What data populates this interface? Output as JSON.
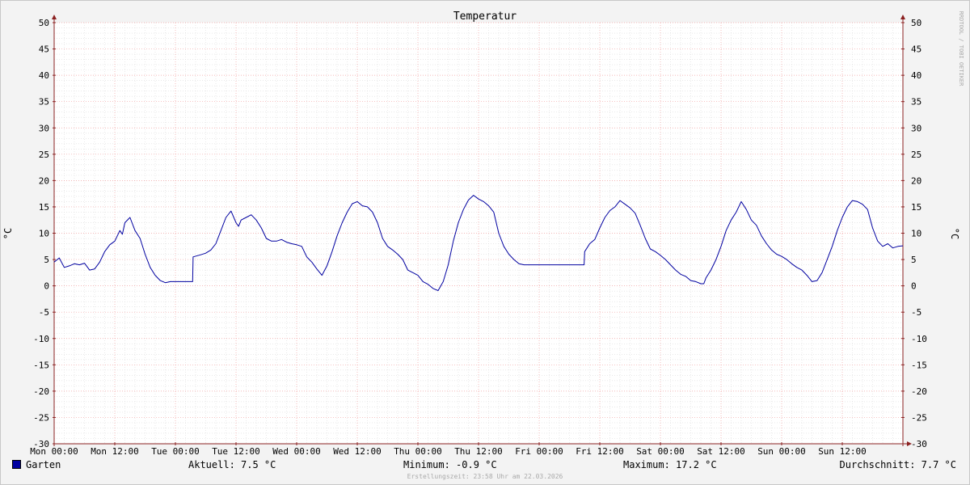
{
  "chart_data": {
    "type": "line",
    "title": "Temperatur",
    "ylabel": "°C",
    "ylabel_right": "°C",
    "watermark": "RRDTOOL / TOBI OETIKER",
    "ylim": [
      -30,
      50
    ],
    "y_ticks": [
      50,
      45,
      40,
      35,
      30,
      25,
      20,
      15,
      10,
      5,
      0,
      -5,
      -10,
      -15,
      -20,
      -25,
      -30
    ],
    "xlim": [
      0,
      168
    ],
    "x_ticks": [
      {
        "x": 0,
        "label": "Mon 00:00"
      },
      {
        "x": 12,
        "label": "Mon 12:00"
      },
      {
        "x": 24,
        "label": "Tue 00:00"
      },
      {
        "x": 36,
        "label": "Tue 12:00"
      },
      {
        "x": 48,
        "label": "Wed 00:00"
      },
      {
        "x": 60,
        "label": "Wed 12:00"
      },
      {
        "x": 72,
        "label": "Thu 00:00"
      },
      {
        "x": 84,
        "label": "Thu 12:00"
      },
      {
        "x": 96,
        "label": "Fri 00:00"
      },
      {
        "x": 108,
        "label": "Fri 12:00"
      },
      {
        "x": 120,
        "label": "Sat 00:00"
      },
      {
        "x": 132,
        "label": "Sat 12:00"
      },
      {
        "x": 144,
        "label": "Sun 00:00"
      },
      {
        "x": 156,
        "label": "Sun 12:00"
      }
    ],
    "grid": true,
    "legend_position": "bottom-left",
    "series": [
      {
        "name": "Garten",
        "color": "#0000a0",
        "points": [
          [
            0,
            4.5
          ],
          [
            1,
            5.3
          ],
          [
            2,
            3.5
          ],
          [
            3,
            3.8
          ],
          [
            4,
            4.2
          ],
          [
            5,
            4.0
          ],
          [
            6,
            4.3
          ],
          [
            7,
            3.0
          ],
          [
            8,
            3.2
          ],
          [
            9,
            4.5
          ],
          [
            10,
            6.5
          ],
          [
            11,
            7.8
          ],
          [
            12,
            8.5
          ],
          [
            13,
            10.5
          ],
          [
            13.5,
            9.8
          ],
          [
            14,
            12.0
          ],
          [
            15,
            13.0
          ],
          [
            16,
            10.5
          ],
          [
            17,
            9.0
          ],
          [
            18,
            6.0
          ],
          [
            19,
            3.5
          ],
          [
            20,
            2.0
          ],
          [
            21,
            1.0
          ],
          [
            22,
            0.6
          ],
          [
            23,
            0.8
          ],
          [
            24,
            0.8
          ],
          [
            25,
            0.8
          ],
          [
            27.4,
            0.8
          ],
          [
            27.5,
            5.5
          ],
          [
            29,
            5.9
          ],
          [
            30,
            6.2
          ],
          [
            31,
            6.8
          ],
          [
            32,
            8.0
          ],
          [
            33,
            10.5
          ],
          [
            34,
            13.0
          ],
          [
            35,
            14.2
          ],
          [
            36,
            12.0
          ],
          [
            36.5,
            11.3
          ],
          [
            37,
            12.5
          ],
          [
            38,
            13.0
          ],
          [
            39,
            13.5
          ],
          [
            40,
            12.5
          ],
          [
            41,
            11.0
          ],
          [
            42,
            9.0
          ],
          [
            43,
            8.5
          ],
          [
            44,
            8.5
          ],
          [
            45,
            8.8
          ],
          [
            46,
            8.3
          ],
          [
            47,
            8.0
          ],
          [
            48,
            7.8
          ],
          [
            49,
            7.5
          ],
          [
            50,
            5.5
          ],
          [
            51,
            4.5
          ],
          [
            52,
            3.2
          ],
          [
            53,
            2.0
          ],
          [
            54,
            3.8
          ],
          [
            55,
            6.5
          ],
          [
            56,
            9.5
          ],
          [
            57,
            12.0
          ],
          [
            58,
            14.0
          ],
          [
            59,
            15.6
          ],
          [
            60,
            16.0
          ],
          [
            61,
            15.2
          ],
          [
            62,
            15.0
          ],
          [
            63,
            14.0
          ],
          [
            64,
            12.0
          ],
          [
            65,
            9.0
          ],
          [
            66,
            7.5
          ],
          [
            67,
            6.8
          ],
          [
            68,
            6.0
          ],
          [
            69,
            5.0
          ],
          [
            70,
            3.0
          ],
          [
            71,
            2.5
          ],
          [
            72,
            2.0
          ],
          [
            73,
            0.8
          ],
          [
            74,
            0.3
          ],
          [
            75,
            -0.5
          ],
          [
            76,
            -0.9
          ],
          [
            77,
            0.8
          ],
          [
            78,
            4.0
          ],
          [
            79,
            8.5
          ],
          [
            80,
            12.0
          ],
          [
            81,
            14.5
          ],
          [
            82,
            16.3
          ],
          [
            83,
            17.2
          ],
          [
            84,
            16.5
          ],
          [
            85,
            16.0
          ],
          [
            86,
            15.2
          ],
          [
            87,
            14.0
          ],
          [
            88,
            10.0
          ],
          [
            89,
            7.5
          ],
          [
            90,
            6.0
          ],
          [
            91,
            5.0
          ],
          [
            92,
            4.2
          ],
          [
            93,
            4.0
          ],
          [
            97,
            4.0
          ],
          [
            101,
            4.0
          ],
          [
            104.9,
            4.0
          ],
          [
            105,
            6.5
          ],
          [
            106,
            8.0
          ],
          [
            107,
            8.8
          ],
          [
            108,
            11.0
          ],
          [
            109,
            13.0
          ],
          [
            110,
            14.3
          ],
          [
            111,
            15.0
          ],
          [
            112,
            16.2
          ],
          [
            113,
            15.5
          ],
          [
            114,
            14.8
          ],
          [
            115,
            13.8
          ],
          [
            116,
            11.5
          ],
          [
            117,
            9.0
          ],
          [
            118,
            7.0
          ],
          [
            119,
            6.5
          ],
          [
            120,
            5.8
          ],
          [
            121,
            5.0
          ],
          [
            122,
            4.0
          ],
          [
            123,
            3.0
          ],
          [
            124,
            2.2
          ],
          [
            125,
            1.8
          ],
          [
            126,
            1.0
          ],
          [
            127,
            0.8
          ],
          [
            128,
            0.4
          ],
          [
            128.6,
            0.4
          ],
          [
            129,
            1.5
          ],
          [
            130,
            3.0
          ],
          [
            131,
            5.0
          ],
          [
            132,
            7.5
          ],
          [
            133,
            10.5
          ],
          [
            134,
            12.5
          ],
          [
            135,
            14.0
          ],
          [
            136,
            16.0
          ],
          [
            137,
            14.5
          ],
          [
            138,
            12.5
          ],
          [
            139,
            11.5
          ],
          [
            140,
            9.5
          ],
          [
            141,
            8.0
          ],
          [
            142,
            6.8
          ],
          [
            143,
            6.0
          ],
          [
            144,
            5.6
          ],
          [
            145,
            5.0
          ],
          [
            146,
            4.2
          ],
          [
            147,
            3.5
          ],
          [
            148,
            3.0
          ],
          [
            149,
            2.0
          ],
          [
            150,
            0.8
          ],
          [
            151,
            1.0
          ],
          [
            152,
            2.5
          ],
          [
            153,
            5.0
          ],
          [
            154,
            7.5
          ],
          [
            155,
            10.5
          ],
          [
            156,
            13.0
          ],
          [
            157,
            15.0
          ],
          [
            158,
            16.2
          ],
          [
            159,
            16.0
          ],
          [
            160,
            15.5
          ],
          [
            161,
            14.5
          ],
          [
            162,
            11.0
          ],
          [
            163,
            8.5
          ],
          [
            164,
            7.5
          ],
          [
            165,
            8.0
          ],
          [
            166,
            7.2
          ],
          [
            167,
            7.5
          ],
          [
            168,
            7.6
          ]
        ]
      }
    ]
  },
  "legend": {
    "series_name": "Garten",
    "current": "Aktuell: 7.5 °C",
    "minimum": "Minimum: -0.9 °C",
    "maximum": "Maximum: 17.2 °C",
    "average": "Durchschnitt: 7.7 °C"
  },
  "footer": "Erstellungszeit: 23:58 Uhr am 22.03.2026"
}
